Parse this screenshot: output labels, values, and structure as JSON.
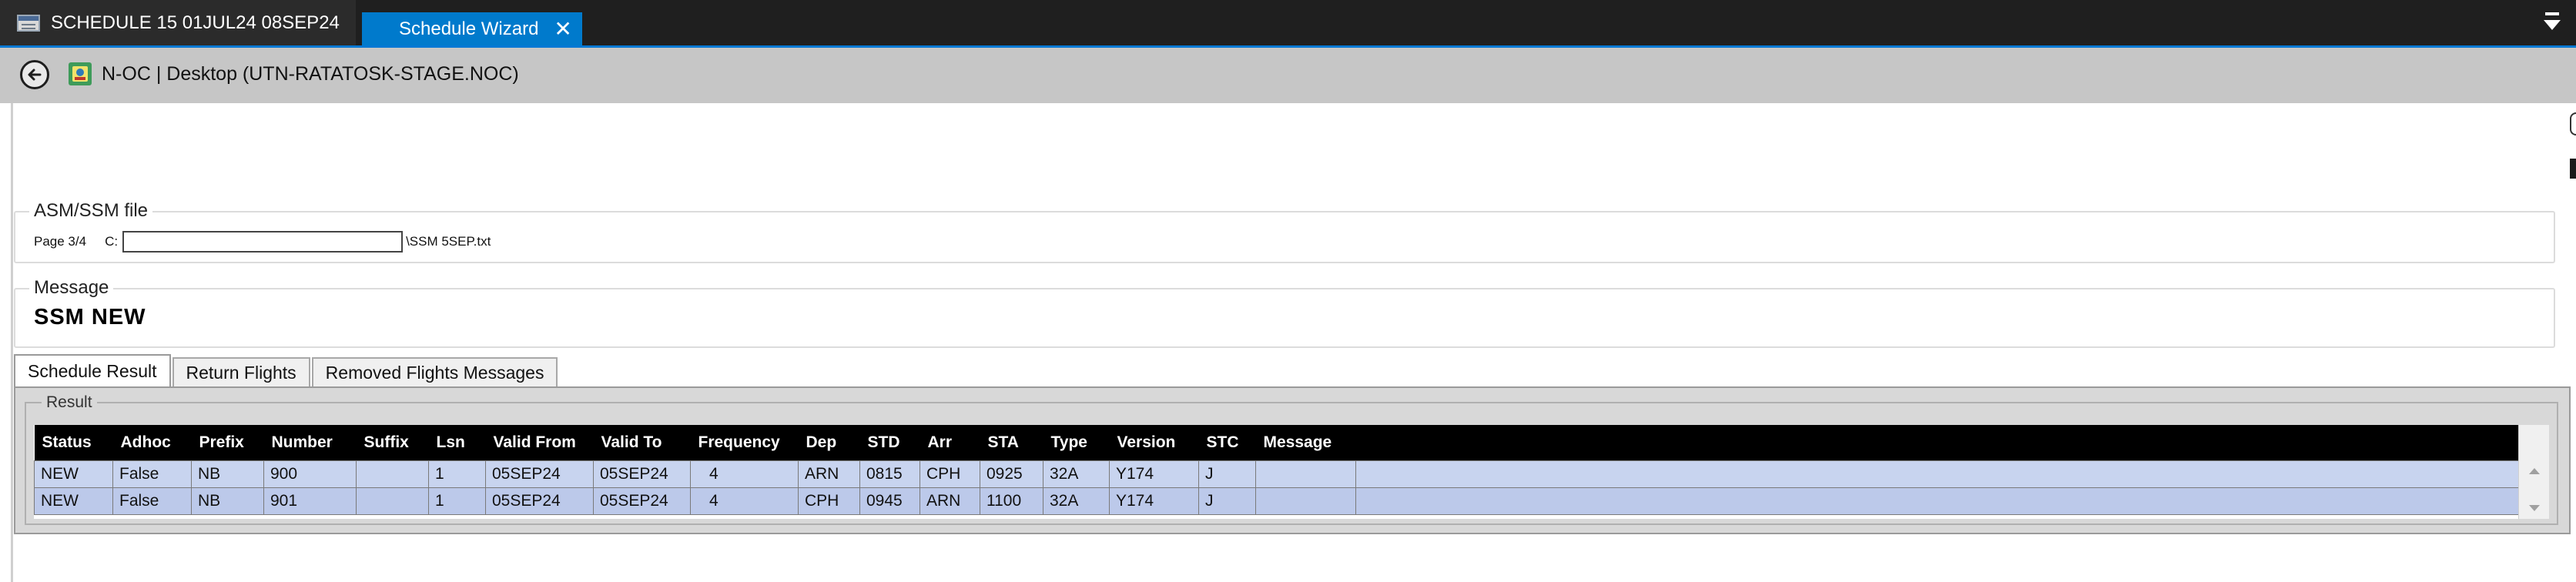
{
  "titlebar": {
    "document_tab": "SCHEDULE 15  01JUL24 08SEP24",
    "active_tab": "Schedule Wizard",
    "close_glyph": "✕"
  },
  "navbar": {
    "location": "N-OC | Desktop (UTN-RATATOSK-STAGE.NOC)"
  },
  "asm_file": {
    "label": "ASM/SSM file",
    "page": "Page 3/4",
    "drive": "C:",
    "path_value": "",
    "filename": "\\SSM 5SEP.txt"
  },
  "message": {
    "label": "Message",
    "text": "SSM  NEW"
  },
  "tabs": [
    {
      "label": "Schedule Result"
    },
    {
      "label": "Return Flights"
    },
    {
      "label": "Removed Flights Messages"
    }
  ],
  "result": {
    "label": "Result",
    "columns": [
      "Status",
      "Adhoc",
      "Prefix",
      "Number",
      "Suffix",
      "Lsn",
      "Valid From",
      "Valid To",
      "Frequency",
      "Dep",
      "STD",
      "Arr",
      "STA",
      "Type",
      "Version",
      "STC",
      "Message"
    ],
    "rows": [
      [
        "NEW",
        "False",
        "NB",
        "900",
        "",
        "1",
        "05SEP24",
        "05SEP24",
        "4",
        "ARN",
        "0815",
        "CPH",
        "0925",
        "32A",
        "Y174",
        "J",
        ""
      ],
      [
        "NEW",
        "False",
        "NB",
        "901",
        "",
        "1",
        "05SEP24",
        "05SEP24",
        "4",
        "CPH",
        "0945",
        "ARN",
        "1100",
        "32A",
        "Y174",
        "J",
        ""
      ]
    ]
  },
  "colors": {
    "tab_accent": "#007acc",
    "grid_header": "#000000",
    "row_fill": "#c8d4ef",
    "navbar": "#c6c6c6"
  },
  "icons": [
    "calendar-icon",
    "close-icon",
    "menu-arrow-icon",
    "back-arrow-icon",
    "app-icon"
  ]
}
